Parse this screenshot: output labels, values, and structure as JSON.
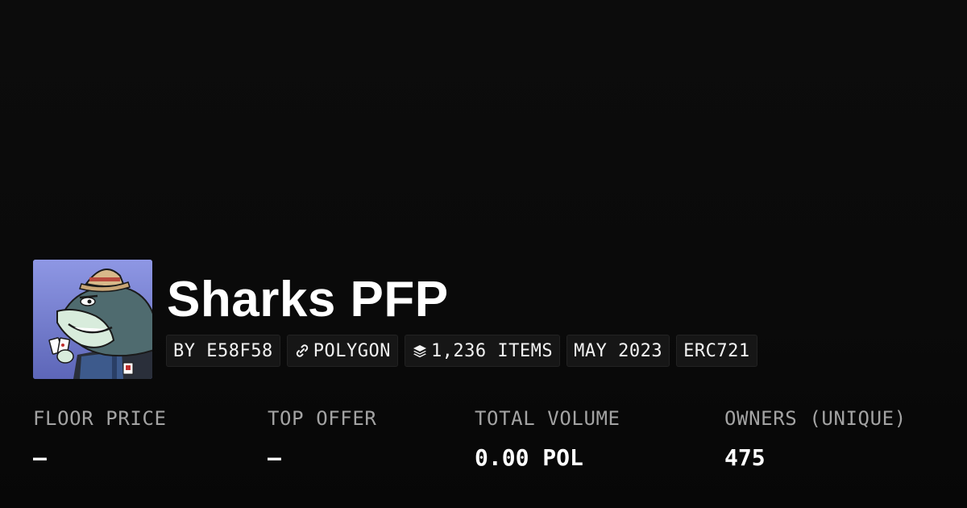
{
  "collection": {
    "title": "Sharks PFP",
    "avatar_icon": "shark-avatar"
  },
  "badges": {
    "creator": "BY E58F58",
    "chain": "POLYGON",
    "chain_icon": "link-icon",
    "items": "1,236 ITEMS",
    "items_icon": "layers-icon",
    "date": "MAY 2023",
    "standard": "ERC721"
  },
  "stats": {
    "floor_label": "FLOOR PRICE",
    "floor_value": "–",
    "offer_label": "TOP OFFER",
    "offer_value": "–",
    "volume_label": "TOTAL VOLUME",
    "volume_value": "0.00 POL",
    "owners_label": "OWNERS (UNIQUE)",
    "owners_value": "475"
  },
  "colors": {
    "background": "#0a0a0a",
    "badge_bg": "#161616",
    "label": "#a3a3a3",
    "text": "#ffffff"
  }
}
